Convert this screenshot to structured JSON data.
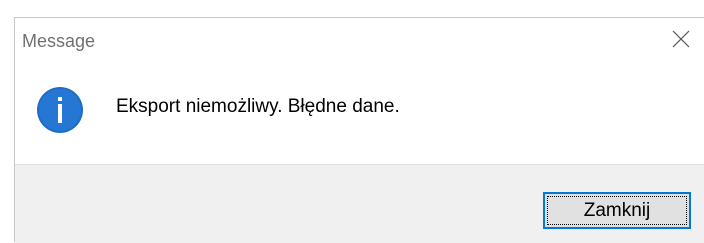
{
  "window": {
    "title": "Message",
    "close_icon": "close-icon"
  },
  "message": {
    "icon": "info-icon",
    "text": "Eksport niemożliwy. Błędne dane."
  },
  "footer": {
    "close_button_label": "Zamknij"
  },
  "colors": {
    "accent": "#0078d7",
    "footer_bg": "#f0f0f0",
    "button_bg": "#e1e1e1"
  }
}
